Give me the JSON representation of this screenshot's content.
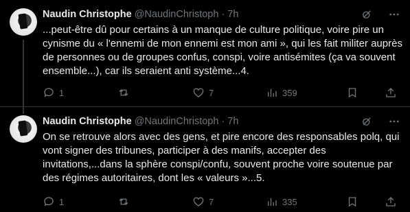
{
  "tweets": [
    {
      "author_name": "Naudin Christophe",
      "author_handle": "@NaudinChristoph",
      "separator": "·",
      "time": "7h",
      "text": "...peut-être dû pour certains à un manque de culture politique, voire pire un cynisme du « l'ennemi de mon ennemi est mon ami », qui les fait militer auprès de personnes ou de groupes confus, conspi, voire antisémites (ça va souvent ensemble...), car ils seraient anti système...4.",
      "replies": "1",
      "retweets": "",
      "likes": "7",
      "views": "359"
    },
    {
      "author_name": "Naudin Christophe",
      "author_handle": "@NaudinChristoph",
      "separator": "·",
      "time": "7h",
      "text": "On se retrouve alors avec des gens, et pire encore des responsables polq, qui vont signer des tribunes, participer à des manifs, accepter des invitations,...dans la sphère conspi/confu, souvent proche voire soutenue par des régimes autoritaires, dont les « valeurs »...5.",
      "replies": "1",
      "retweets": "",
      "likes": "7",
      "views": "335"
    }
  ],
  "icons": {
    "grok": "grok-icon",
    "more": "more-icon",
    "reply": "reply-icon",
    "retweet": "retweet-icon",
    "like": "heart-icon",
    "views": "views-icon",
    "bookmark": "bookmark-icon",
    "share": "share-icon"
  },
  "colors": {
    "background": "#000000",
    "text": "#e7e9ea",
    "secondary": "#71767b",
    "divider": "#2f3336"
  }
}
